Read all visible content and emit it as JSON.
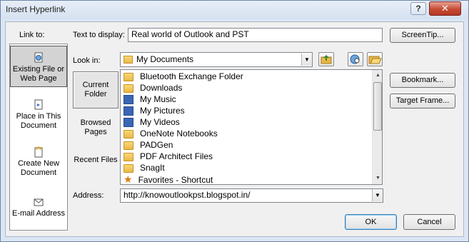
{
  "window": {
    "title": "Insert Hyperlink",
    "help_label": "?",
    "close_label": "✕"
  },
  "link_to": {
    "label": "Link to:",
    "items": [
      {
        "label": "Existing File or Web Page",
        "icon": "web-page-icon",
        "selected": true
      },
      {
        "label": "Place in This Document",
        "icon": "document-place-icon"
      },
      {
        "label": "Create New Document",
        "icon": "new-document-icon"
      },
      {
        "label": "E-mail Address",
        "icon": "email-icon"
      }
    ]
  },
  "text_to_display": {
    "label": "Text to display:",
    "value": "Real world of Outlook and PST"
  },
  "screentip_label": "ScreenTip...",
  "look_in": {
    "label": "Look in:",
    "value": "My Documents",
    "folder_icon": "folder-icon"
  },
  "places": [
    {
      "label": "Current Folder",
      "selected": true
    },
    {
      "label": "Browsed Pages"
    },
    {
      "label": "Recent Files"
    }
  ],
  "files": [
    {
      "name": "Bluetooth Exchange Folder",
      "icon": "folder-icon"
    },
    {
      "name": "Downloads",
      "icon": "folder-icon"
    },
    {
      "name": "My Music",
      "icon": "library-icon"
    },
    {
      "name": "My Pictures",
      "icon": "library-icon"
    },
    {
      "name": "My Videos",
      "icon": "library-icon"
    },
    {
      "name": "OneNote Notebooks",
      "icon": "folder-icon"
    },
    {
      "name": "PADGen",
      "icon": "folder-icon"
    },
    {
      "name": "PDF Architect Files",
      "icon": "folder-icon"
    },
    {
      "name": "SnagIt",
      "icon": "folder-icon"
    },
    {
      "name": "Favorites - Shortcut",
      "icon": "shortcut-star-icon"
    }
  ],
  "address": {
    "label": "Address:",
    "value": "http://knowoutlookpst.blogspot.in/"
  },
  "right_buttons": {
    "bookmark": "Bookmark...",
    "target_frame": "Target Frame..."
  },
  "footer": {
    "ok": "OK",
    "cancel": "Cancel"
  }
}
